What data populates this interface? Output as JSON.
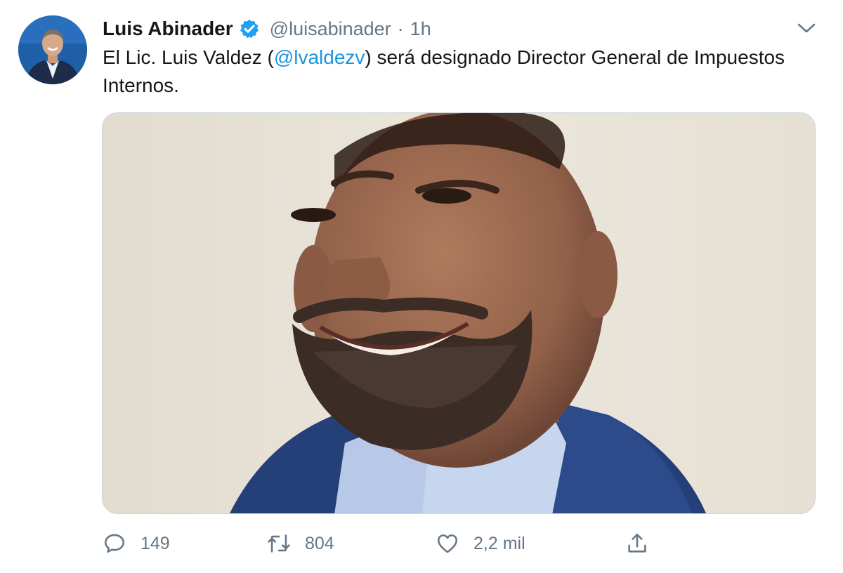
{
  "tweet": {
    "display_name": "Luis Abinader",
    "handle": "@luisabinader",
    "separator": "·",
    "timestamp": "1h",
    "text_before": "El Lic. Luis Valdez (",
    "mention": "@lvaldezv",
    "text_after": ") será designado Director General de Impuestos Internos.",
    "verified": true,
    "verified_color": "#1da1f2",
    "mention_color": "#1b95e0"
  },
  "icons": {
    "verified": "verified-badge-icon",
    "caret": "chevron-down-icon",
    "reply": "comment-icon",
    "retweet": "retweet-icon",
    "like": "heart-icon",
    "share": "share-icon"
  },
  "actions": {
    "reply_count": "149",
    "retweet_count": "804",
    "like_count": "2,2 mil"
  }
}
